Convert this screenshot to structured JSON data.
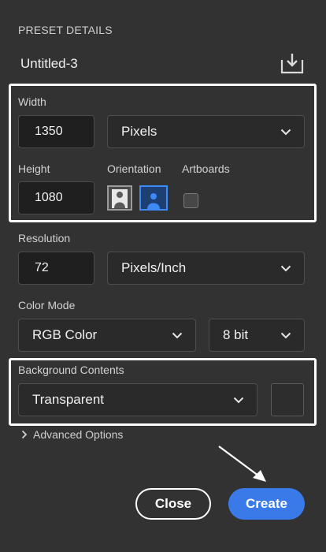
{
  "preset": {
    "section_title": "PRESET DETAILS",
    "name": "Untitled-3",
    "save_icon": "save-preset-icon"
  },
  "width": {
    "label": "Width",
    "value": "1350",
    "unit": "Pixels"
  },
  "height": {
    "label": "Height",
    "value": "1080"
  },
  "orientation": {
    "label": "Orientation",
    "options": [
      "portrait",
      "landscape"
    ],
    "selected": "landscape"
  },
  "artboards": {
    "label": "Artboards",
    "checked": false
  },
  "resolution": {
    "label": "Resolution",
    "value": "72",
    "unit": "Pixels/Inch"
  },
  "color_mode": {
    "label": "Color Mode",
    "mode": "RGB Color",
    "depth": "8 bit"
  },
  "background": {
    "label": "Background Contents",
    "value": "Transparent"
  },
  "advanced": {
    "label": "Advanced Options"
  },
  "buttons": {
    "close": "Close",
    "create": "Create"
  },
  "colors": {
    "panel_bg": "#323232",
    "accent": "#3a7ae8",
    "highlight_box": "#ffffff"
  }
}
